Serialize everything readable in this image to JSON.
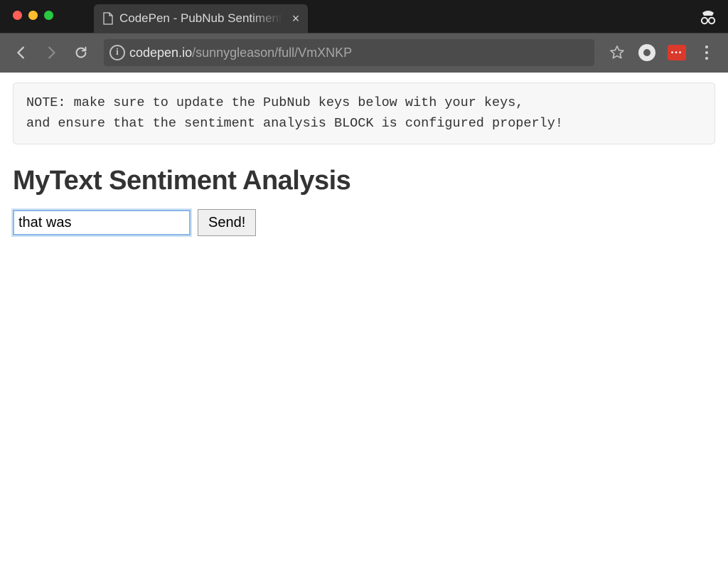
{
  "browser": {
    "tab_title": "CodePen - PubNub Sentiment",
    "url_host": "codepen.io",
    "url_path": "/sunnygleason/full/VmXNKP"
  },
  "note": "NOTE: make sure to update the PubNub keys below with your keys,\nand ensure that the sentiment analysis BLOCK is configured properly!",
  "heading": "MyText Sentiment Analysis",
  "form": {
    "input_value": "that was ",
    "send_label": "Send!"
  }
}
